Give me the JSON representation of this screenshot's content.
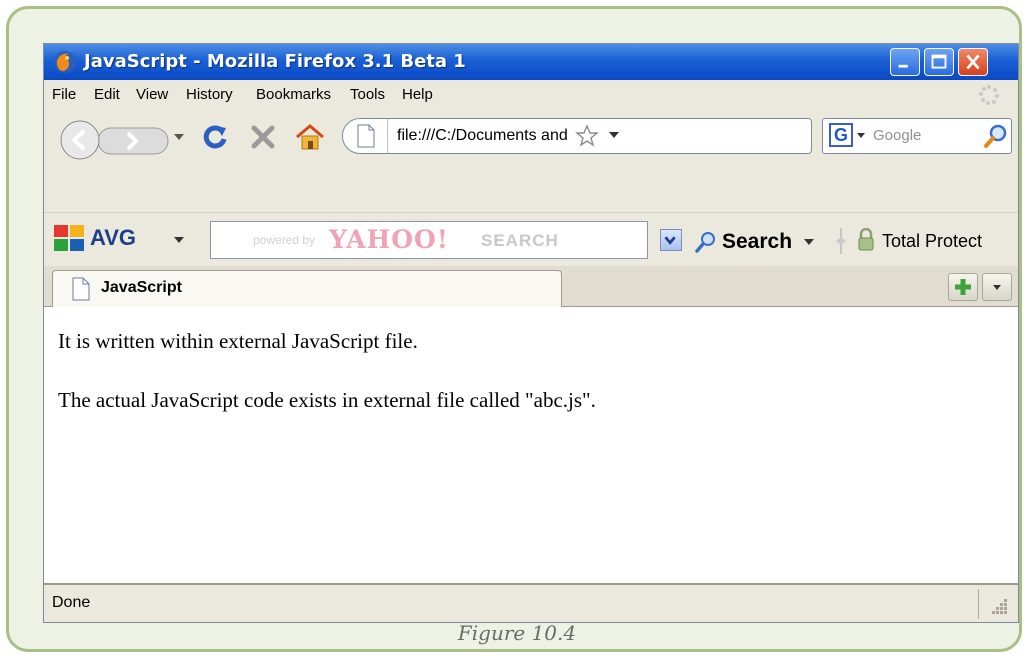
{
  "window": {
    "title": "JavaScript - Mozilla Firefox 3.1 Beta 1",
    "icon": "firefox-icon"
  },
  "menu": {
    "items": [
      "File",
      "Edit",
      "View",
      "History",
      "Bookmarks",
      "Tools",
      "Help"
    ]
  },
  "navigation": {
    "url": "file:///C:/Documents and Settings/",
    "search_placeholder": "Google",
    "search_engine_icon": "G"
  },
  "avg_toolbar": {
    "brand": "AVG",
    "powered_by": "powered by",
    "yahoo_logo": "YAHOO!",
    "yahoo_search": "SEARCH",
    "search_label": "Search",
    "total_protection": "Total Protect"
  },
  "tabs": [
    {
      "label": "JavaScript"
    }
  ],
  "content": {
    "lines": [
      "It is written within external JavaScript file.",
      "The actual JavaScript code exists in external file called \"abc.js\"."
    ]
  },
  "status": {
    "text": "Done"
  },
  "caption": "Figure 10.4",
  "colors": {
    "titlebar": "#1a5fd6",
    "chrome": "#ebe9de",
    "frame_border": "#a8bf86",
    "avg_blue": "#1d3e8a"
  }
}
